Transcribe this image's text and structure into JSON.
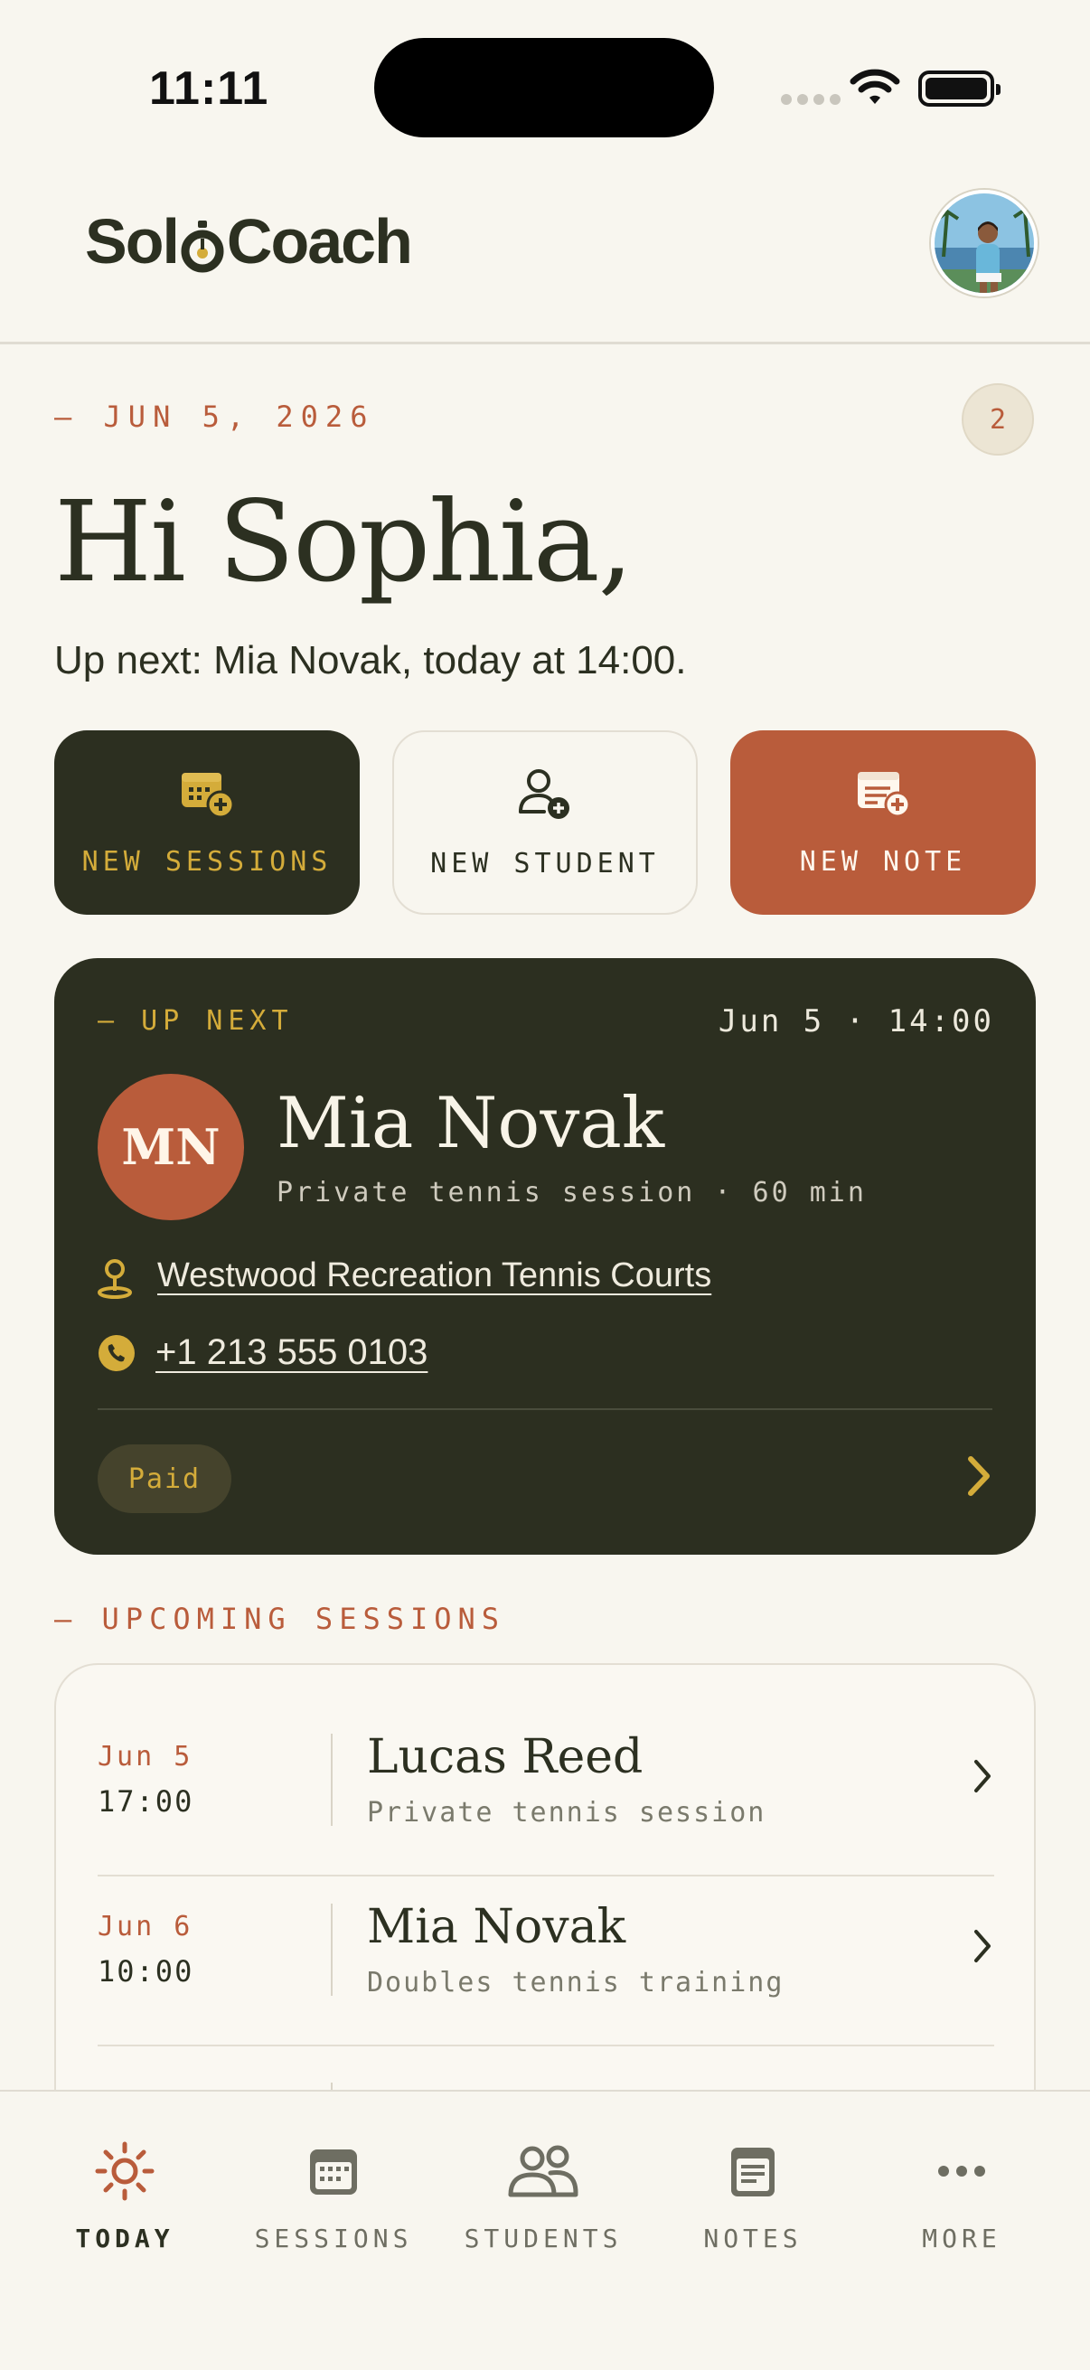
{
  "status_bar": {
    "time": "11:11"
  },
  "header": {
    "logo_text_left": "Sol",
    "logo_text_right": "Coach"
  },
  "greeting": {
    "date": "— JUN 5, 2026",
    "notification_count": "2",
    "title": "Hi Sophia,",
    "subtitle": "Up next: Mia Novak, today at 14:00."
  },
  "quick_actions": [
    {
      "label": "NEW SESSIONS",
      "icon": "calendar-plus-icon"
    },
    {
      "label": "NEW STUDENT",
      "icon": "user-plus-icon"
    },
    {
      "label": "NEW NOTE",
      "icon": "note-plus-icon"
    }
  ],
  "up_next": {
    "label": "— UP NEXT",
    "when": "Jun 5 · 14:00",
    "initials": "MN",
    "name": "Mia Novak",
    "details": "Private tennis session · 60 min",
    "location": "Westwood Recreation Tennis Courts",
    "phone": "+1 213 555 0103",
    "payment_status": "Paid"
  },
  "upcoming": {
    "label": "— UPCOMING SESSIONS",
    "sessions": [
      {
        "date": "Jun 5",
        "time": "17:00",
        "name": "Lucas Reed",
        "type": "Private tennis session"
      },
      {
        "date": "Jun 6",
        "time": "10:00",
        "name": "Mia Novak",
        "type": "Doubles tennis training"
      }
    ]
  },
  "tabs": [
    {
      "label": "TODAY",
      "icon": "sun-icon",
      "active": true
    },
    {
      "label": "SESSIONS",
      "icon": "calendar-icon"
    },
    {
      "label": "STUDENTS",
      "icon": "users-icon"
    },
    {
      "label": "NOTES",
      "icon": "notes-icon"
    },
    {
      "label": "MORE",
      "icon": "more-icon"
    }
  ],
  "colors": {
    "background": "#F8F6EF",
    "dark_olive": "#2C2F20",
    "terracotta": "#B95C3B",
    "gold": "#D4AC3A"
  }
}
